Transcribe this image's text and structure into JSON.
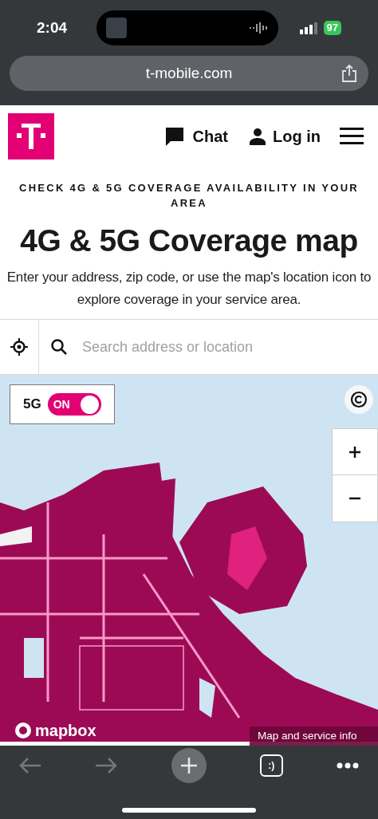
{
  "status_bar": {
    "time": "2:04",
    "battery": "97"
  },
  "browser": {
    "url": "t-mobile.com",
    "tab_count": ":)"
  },
  "header": {
    "chat": "Chat",
    "login": "Log in"
  },
  "eyebrow": "CHECK 4G & 5G COVERAGE AVAILABILITY IN YOUR AREA",
  "title": "4G & 5G Coverage map",
  "intro": "Enter your address, zip code, or use the map's location icon to explore coverage in your service area.",
  "search": {
    "placeholder": "Search address or location"
  },
  "map": {
    "toggle": {
      "label": "5G",
      "state": "ON",
      "on": true
    },
    "attribution": "mapbox",
    "info": "Map and service info"
  }
}
